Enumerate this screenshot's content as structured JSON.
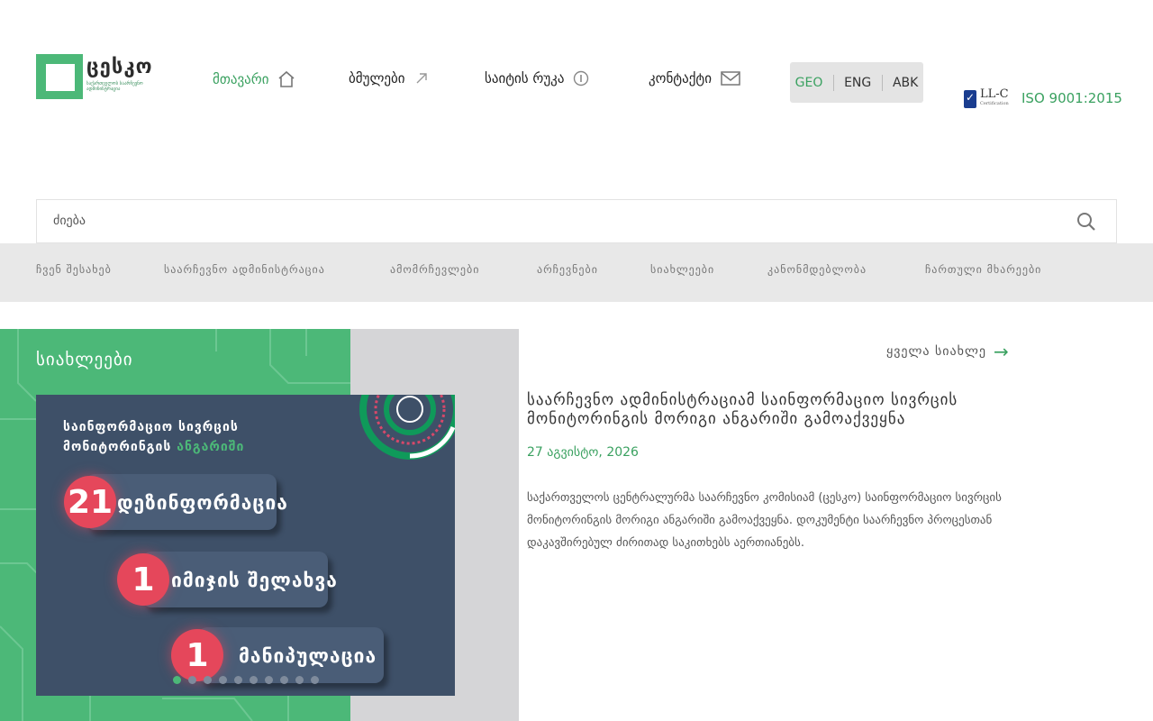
{
  "logo": {
    "title": "ცესკო",
    "subtitle": "საქართველოს საარჩევნო ადმინისტრაცია"
  },
  "topnav": [
    {
      "label": "მთავარი",
      "icon": "home-icon",
      "active": true
    },
    {
      "label": "ბმულები",
      "icon": "arrow-up-right-icon",
      "active": false
    },
    {
      "label": "საიტის რუკა",
      "icon": "info-icon",
      "active": false
    },
    {
      "label": "კონტაქტი",
      "icon": "mail-icon",
      "active": false
    }
  ],
  "languages": [
    {
      "label": "GEO",
      "active": true
    },
    {
      "label": "ENG",
      "active": false
    },
    {
      "label": "ABK",
      "active": false
    }
  ],
  "certification": {
    "badge": "LL-C",
    "badge_sub": "Certification",
    "iso": "ISO 9001:2015"
  },
  "search": {
    "placeholder": "ძიება"
  },
  "menu": [
    "ჩვენ შესახებ",
    "საარჩევნო ადმინისტრაცია",
    "ამომრჩევლები",
    "არჩევნები",
    "სიახლეები",
    "კანონმდებლობა",
    "ჩართული მხარეები"
  ],
  "news": {
    "heading": "სიახლეები",
    "all_news": "ყველა სიახლე",
    "slide": {
      "title_line1": "საინფორმაციო სივრცის",
      "title_line2_a": "მონიტორინგის",
      "title_line2_b": "ანგარიში",
      "items": [
        {
          "count": "21",
          "label": "დეზინფორმაცია"
        },
        {
          "count": "1",
          "label": "იმიჯის შელახვა"
        },
        {
          "count": "1",
          "label": "მანიპულაცია"
        }
      ],
      "dot_count": 10,
      "active_dot": 0
    },
    "article": {
      "title": "საარჩევნო ადმინისტრაციამ საინფორმაციო სივრცის მონიტორინგის მორიგი ანგარიში გამოაქვეყნა",
      "date": "27 აგვისტო, 2026",
      "body": "საქართველოს ცენტრალურმა საარჩევნო კომისიამ (ცესკო) საინფორმაციო სივრცის მონიტორინგის მორიგი ანგარიში გამოაქვეყნა. დოკუმენტი საარჩევნო პროცესთან დაკავშირებულ ძირითად საკითხებს აერთიანებს."
    }
  },
  "colors": {
    "accent": "#3aa160",
    "green_panel": "#4cb878",
    "slide_bg": "#3e5068",
    "badge_red": "#e5475b"
  }
}
